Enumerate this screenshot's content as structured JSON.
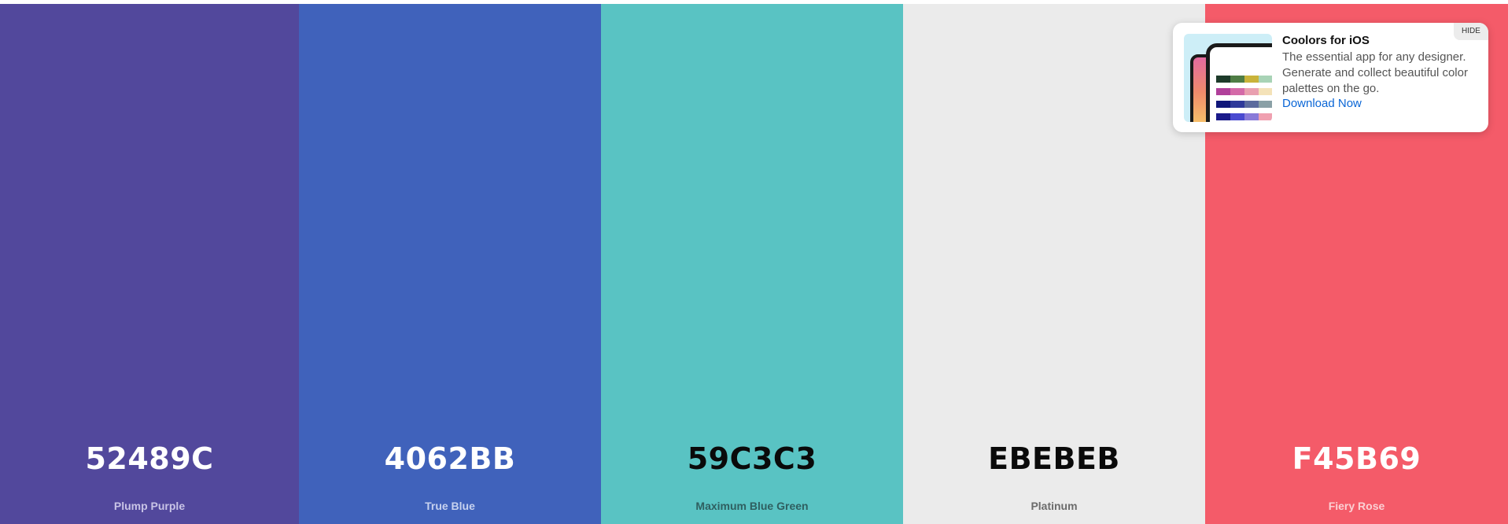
{
  "palette": [
    {
      "hex": "52489C",
      "name": "Plump Purple",
      "color": "#52489C",
      "hex_color": "#ffffff",
      "name_color": "#c9c4e6"
    },
    {
      "hex": "4062BB",
      "name": "True Blue",
      "color": "#4062BB",
      "hex_color": "#ffffff",
      "name_color": "#c7d2ef"
    },
    {
      "hex": "59C3C3",
      "name": "Maximum Blue Green",
      "color": "#59C3C3",
      "hex_color": "#0a0a0a",
      "name_color": "#2f5f60"
    },
    {
      "hex": "EBEBEB",
      "name": "Platinum",
      "color": "#EBEBEB",
      "hex_color": "#0a0a0a",
      "name_color": "#6b6b6b"
    },
    {
      "hex": "F45B69",
      "name": "Fiery Rose",
      "color": "#F45B69",
      "hex_color": "#ffffff",
      "name_color": "#fbd0d4"
    }
  ],
  "promo": {
    "title": "Coolors for iOS",
    "description": "The essential app for any designer. Generate and collect beautiful color palettes on the go.",
    "link": "Download Now",
    "hide": "HIDE",
    "thumbnail_icon": "phone-app-preview"
  }
}
